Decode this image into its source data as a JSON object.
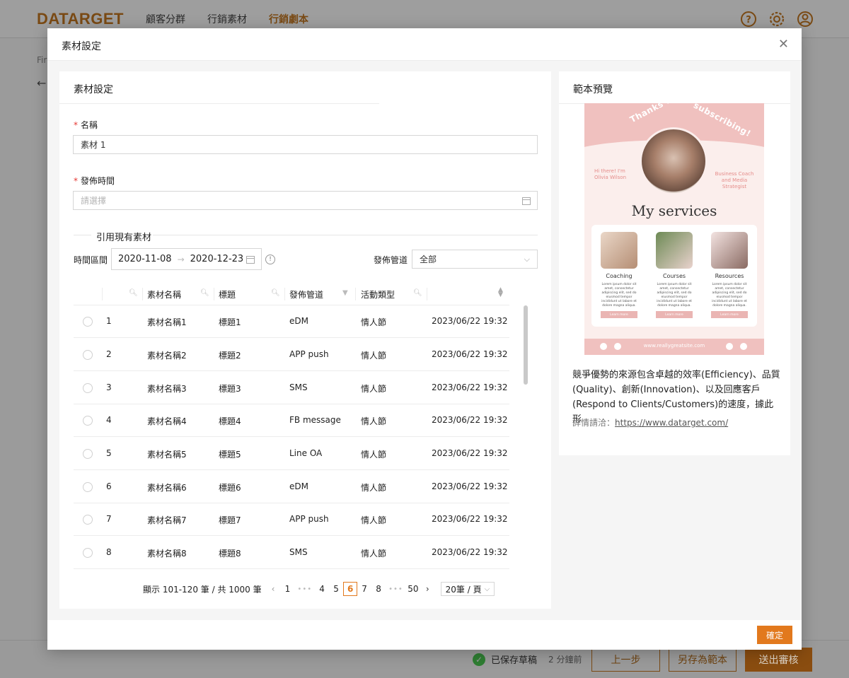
{
  "header": {
    "logo": "DATARGET",
    "nav": [
      "顧客分群",
      "行銷素材",
      "行銷劇本"
    ],
    "active_nav": "行銷劇本",
    "icons": [
      "help-icon",
      "settings-icon",
      "user-icon"
    ]
  },
  "background": {
    "breadcrumb_fragment": "Fir"
  },
  "footer": {
    "saved_label": "已保存草稿",
    "saved_ago": "2 分鐘前",
    "prev_button": "上一步",
    "save_template_button": "另存為範本",
    "submit_button": "送出審核"
  },
  "modal": {
    "title": "素材設定",
    "ok_button": "確定",
    "left": {
      "title": "素材設定",
      "name_label": "名稱",
      "name_value": "素材 1",
      "time_label": "發佈時間",
      "time_placeholder": "請選擇",
      "section_title": "引用現有素材",
      "range_label": "時間區間",
      "range_start": "2020-11-08",
      "range_end": "2020-12-23",
      "channel_label": "發佈管道",
      "channel_value": "全部",
      "table": {
        "headers": [
          "素材名稱",
          "標題",
          "發佈管道",
          "活動類型"
        ],
        "rows": [
          {
            "no": "1",
            "name": "素材名稱1",
            "title": "標題1",
            "channel": "eDM",
            "type": "情人節",
            "time": "2023/06/22 19:32"
          },
          {
            "no": "2",
            "name": "素材名稱2",
            "title": "標題2",
            "channel": "APP push",
            "type": "情人節",
            "time": "2023/06/22 19:32"
          },
          {
            "no": "3",
            "name": "素材名稱3",
            "title": "標題3",
            "channel": "SMS",
            "type": "情人節",
            "time": "2023/06/22 19:32"
          },
          {
            "no": "4",
            "name": "素材名稱4",
            "title": "標題4",
            "channel": "FB message",
            "type": "情人節",
            "time": "2023/06/22 19:32"
          },
          {
            "no": "5",
            "name": "素材名稱5",
            "title": "標題5",
            "channel": "Line OA",
            "type": "情人節",
            "time": "2023/06/22 19:32"
          },
          {
            "no": "6",
            "name": "素材名稱6",
            "title": "標題6",
            "channel": "eDM",
            "type": "情人節",
            "time": "2023/06/22 19:32"
          },
          {
            "no": "7",
            "name": "素材名稱7",
            "title": "標題7",
            "channel": "APP push",
            "type": "情人節",
            "time": "2023/06/22 19:32"
          },
          {
            "no": "8",
            "name": "素材名稱8",
            "title": "標題8",
            "channel": "SMS",
            "type": "情人節",
            "time": "2023/06/22 19:32"
          }
        ]
      },
      "pagination": {
        "summary": "顯示 101-120 筆 / 共 1000 筆",
        "pages": [
          "1",
          "4",
          "5",
          "6",
          "7",
          "8",
          "50"
        ],
        "current": "6",
        "page_size": "20筆 / 頁"
      }
    },
    "right": {
      "title": "範本預覽",
      "preview": {
        "headline_left": "Thanks for",
        "headline_right": "subscribing!",
        "hi": "Hi there! I'm Olivia Wilson",
        "role": "Business Coach and Media Strategist",
        "services": "My services",
        "cards": [
          {
            "title": "Coaching",
            "text": "Lorem ipsum dolor sit amet, consectetur adipiscing elit, sed do eiusmod tempor incididunt ut labore et dolore magna aliqua.",
            "btn": "Learn more"
          },
          {
            "title": "Courses",
            "text": "Lorem ipsum dolor sit amet, consectetur adipiscing elit, sed do eiusmod tempor incididunt ut labore et dolore magna aliqua.",
            "btn": "Learn more"
          },
          {
            "title": "Resources",
            "text": "Lorem ipsum dolor sit amet, consectetur adipiscing elit, sed do eiusmod tempor incididunt ut labore et dolore magna aliqua.",
            "btn": "Learn more"
          }
        ],
        "url": "www.reallygreatsite.com"
      },
      "description": "競爭優勢的來源包含卓越的效率(Efficiency)、品質(Quality)、創新(Innovation)、以及回應客戶(Respond to Clients/Customers)的速度，據此形",
      "more_label": "詳情請洽：",
      "more_link": "https://www.datarget.com/"
    }
  },
  "colors": {
    "accent": "#e2791d",
    "required": "#e53935",
    "preview_pink": "#f0c1bf"
  }
}
